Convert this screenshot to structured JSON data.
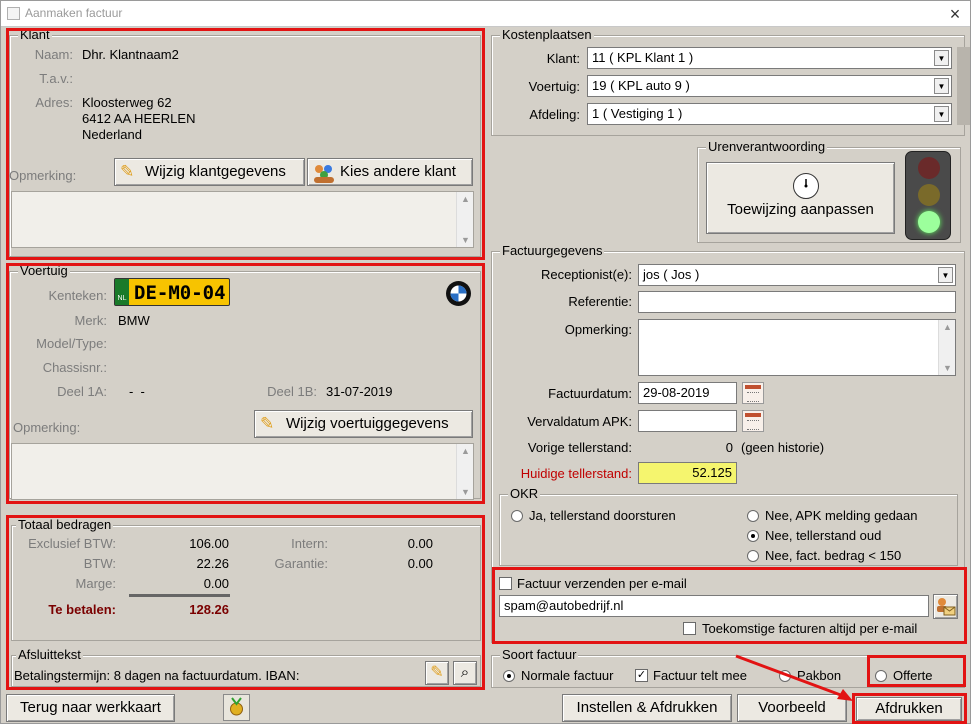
{
  "window": {
    "title": "Aanmaken factuur",
    "close": "×"
  },
  "klant": {
    "heading": "Klant",
    "naam_label": "Naam:",
    "naam": "Dhr. Klantnaam2",
    "tav_label": "T.a.v.:",
    "adres_label": "Adres:",
    "adres_line1": "Kloosterweg 62",
    "adres_line2": "6412 AA HEERLEN",
    "adres_line3": "Nederland",
    "opmerking_label": "Opmerking:",
    "wijzig_button": "Wijzig klantgegevens",
    "kies_button": "Kies andere klant"
  },
  "voertuig": {
    "heading": "Voertuig",
    "kenteken_label": "Kenteken:",
    "kenteken": "DE-M0-04",
    "plate_country": "NL",
    "merk_label": "Merk:",
    "merk": "BMW",
    "model_label": "Model/Type:",
    "chassis_label": "Chassisnr.:",
    "deel1a_label": "Deel 1A:",
    "deel1a": "-  -",
    "deel1b_label": "Deel 1B:",
    "deel1b": "31-07-2019",
    "opmerking_label": "Opmerking:",
    "wijzig_button": "Wijzig voertuiggegevens"
  },
  "totaal": {
    "heading": "Totaal bedragen",
    "excl_label": "Exclusief BTW:",
    "excl": "106.00",
    "btw_label": "BTW:",
    "btw": "22.26",
    "marge_label": "Marge:",
    "marge": "0.00",
    "intern_label": "Intern:",
    "intern": "0.00",
    "garantie_label": "Garantie:",
    "garantie": "0.00",
    "te_betalen_label": "Te betalen:",
    "te_betalen": "128.26"
  },
  "afsluittekst": {
    "heading": "Afsluittekst",
    "text": "Betalingstermijn: 8 dagen na factuurdatum. IBAN:"
  },
  "kostenplaatsen": {
    "heading": "Kostenplaatsen",
    "klant_label": "Klant:",
    "klant": "11 ( KPL Klant 1 )",
    "voertuig_label": "Voertuig:",
    "voertuig": "19 ( KPL auto 9 )",
    "afdeling_label": "Afdeling:",
    "afdeling": "1 ( Vestiging 1 )"
  },
  "urenverantwoording": {
    "heading": "Urenverantwoording",
    "button": "Toewijzing aanpassen",
    "traffic_light_active": "green"
  },
  "factuurgegevens": {
    "heading": "Factuurgegevens",
    "receptionist_label": "Receptionist(e):",
    "receptionist": "jos ( Jos )",
    "referentie_label": "Referentie:",
    "referentie": "",
    "opmerking_label": "Opmerking:",
    "factuurdatum_label": "Factuurdatum:",
    "factuurdatum": "29-08-2019",
    "vervaldatum_label": "Vervaldatum APK:",
    "vervaldatum": "",
    "vorige_label": "Vorige tellerstand:",
    "vorige": "0",
    "vorige_note": "(geen historie)",
    "huidige_label": "Huidige tellerstand:",
    "huidige": "52.125"
  },
  "okr": {
    "heading": "OKR",
    "opt_ja": "Ja, tellerstand doorsturen",
    "opt_apk": "Nee, APK melding gedaan",
    "opt_oud": "Nee, tellerstand oud",
    "opt_bedrag": "Nee, fact. bedrag < 150",
    "selected": "opt_oud"
  },
  "email": {
    "verzenden_label": "Factuur verzenden per e-mail",
    "verzenden_checked": false,
    "address": "spam@autobedrijf.nl",
    "toekomstige_label": "Toekomstige facturen altijd per e-mail",
    "toekomstige_checked": false
  },
  "soort": {
    "heading": "Soort factuur",
    "normaal": "Normale factuur",
    "telt_mee": "Factuur telt mee",
    "pakbon": "Pakbon",
    "offerte": "Offerte",
    "telt_mee_checked": true,
    "selected": "normaal"
  },
  "footer": {
    "terug": "Terug naar werkkaart",
    "instellen": "Instellen & Afdrukken",
    "voorbeeld": "Voorbeeld",
    "afdrukken": "Afdrukken"
  },
  "colors": {
    "highlight_red": "#e21313",
    "plate_yellow": "#f7c300",
    "huidige_bg": "#f5f56e",
    "te_betalen": "#7a0000",
    "huidige_label": "#c00000"
  }
}
